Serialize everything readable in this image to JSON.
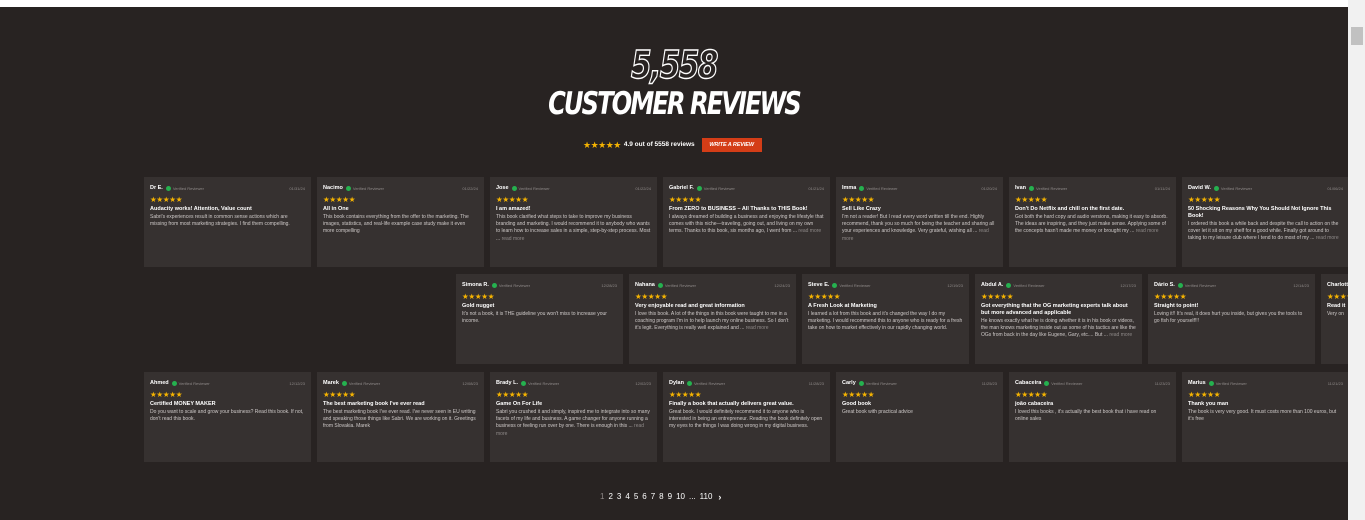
{
  "header": {
    "count": "5,558",
    "title": "CUSTOMER REVIEWS",
    "stars": "★★★★★",
    "summary": "4.9 out of 5558 reviews",
    "write_button": "WRITE A REVIEW"
  },
  "verified_label": "Verified Reviewer",
  "read_more": "read more",
  "rows": [
    [
      {
        "author": "Dr E.",
        "date": "01/31/24",
        "stars": "★★★★★",
        "title": "Audacity works! Attention, Value count",
        "body": "Sabri's experiences result in common sense actions which are missing from most marketing strategies. I find them compelling.",
        "more": false
      },
      {
        "author": "Nacimo",
        "date": "01/22/24",
        "stars": "★★★★★",
        "title": "All in One",
        "body": "This book contains everything from the offer to the marketing. The images, statistics, and real-life example case study make it even more compelling",
        "more": false
      },
      {
        "author": "Jose",
        "date": "01/22/24",
        "stars": "★★★★★",
        "title": "I am amazed!",
        "body": "This book clarified what steps to take to improve my business branding and marketing. I would recommend it to anybody who wants to learn how to increase sales in a simple, step-by-step process. Most ...",
        "more": true
      },
      {
        "author": "Gabriel F.",
        "date": "01/21/24",
        "stars": "★★★★★",
        "title": "From ZERO to BUSINESS – All Thanks to THIS Book!",
        "body": "I always dreamed of building a business and enjoying the lifestyle that comes with this niche—traveling, going out, and living on my own terms. Thanks to this book, six months ago, I went from ...",
        "more": true
      },
      {
        "author": "Imma",
        "date": "01/20/24",
        "stars": "★★★★★",
        "title": "Sell Like Crazy",
        "body": "I'm not a reader! But I read every word written till the end. Highly recommend, thank you so much for being the teacher and sharing all your experiences and knowledge. Very grateful, wishing all ...",
        "more": true
      },
      {
        "author": "Ivan",
        "date": "01/11/24",
        "stars": "★★★★★",
        "title": "Don't Do Netflix and chill on the first date.",
        "body": "Got both the hard copy and audio versions, making it easy to absorb. The ideas are inspiring, and they just make sense. Applying some of the concepts hasn't made me money or brought my ...",
        "more": true
      },
      {
        "author": "David W.",
        "date": "01/06/24",
        "stars": "★★★★★",
        "title": "50 Shocking Reasons Why You Should Not Ignore This Book!",
        "body": "I ordered this book a while back and despite the call to action on the cover let it sit on my shelf for a good while. Finally got around to taking to my leisure club where I tend to do most of my ...",
        "more": true
      }
    ],
    [
      {
        "author": "Simona R.",
        "date": "12/28/23",
        "stars": "★★★★★",
        "title": "Gold nugget",
        "body": "It's not a book, it is THE guideline you won't miss to increase your income.",
        "more": false
      },
      {
        "author": "Nahana",
        "date": "12/24/23",
        "stars": "★★★★★",
        "title": "Very enjoyable read and great information",
        "body": "I love this book. A lot of the things in this book were taught to me in a coaching program I'm in to help launch my online business. So I don't it's legit. Everything is really well explained and ...",
        "more": true
      },
      {
        "author": "Steve E.",
        "date": "12/19/23",
        "stars": "★★★★★",
        "title": "A Fresh Look at Marketing",
        "body": "I learned a lot from this book and it's changed the way I do my marketing. I would recommend this to anyone who is ready for a fresh take on how to market effectively in our rapidly changing world.",
        "more": false
      },
      {
        "author": "Abdul A.",
        "date": "12/17/23",
        "stars": "★★★★★",
        "title": "Got everything that the OG marketing experts talk about but more advanced and applicable",
        "body": "He knows exactly what he is doing whether it is in his book or videos, the man knows marketing inside out as some of his tactics are like the OGs from back in the day like Eugene, Gary, etc.... But ...",
        "more": true
      },
      {
        "author": "Dário S.",
        "date": "12/14/23",
        "stars": "★★★★★",
        "title": "Straight to point!",
        "body": "Loving it!! It's real, it does hurt you inside, but gives you the tools to go fish for yourself!!!",
        "more": false
      },
      {
        "author": "Charlotte",
        "date": "",
        "stars": "★★★★★",
        "title": "Read it",
        "body": "Very on",
        "more": false
      }
    ],
    [
      {
        "author": "Ahmed",
        "date": "12/12/23",
        "stars": "★★★★★",
        "title": "Certified MONEY MAKER",
        "body": "Do you want to scale and grow your business? Read this book. If not, don't read this book.",
        "more": false
      },
      {
        "author": "Marek",
        "date": "12/08/23",
        "stars": "★★★★★",
        "title": "The best marketing book I've ever read",
        "body": "The best marketing book I've ever read. I've never seen in EU writing and speaking those things like Sabri. We are working on it. Greetings from Slovakia. Marek",
        "more": false
      },
      {
        "author": "Brady L.",
        "date": "12/02/23",
        "stars": "★★★★★",
        "title": "Game On For Life",
        "body": "Sabri you crushed it and simply, inspired me to integrate into so many facets of my life and business. A game changer for anyone running a business or feeling run over by one. There is enough in this ...",
        "more": true
      },
      {
        "author": "Dylan",
        "date": "11/28/23",
        "stars": "★★★★★",
        "title": "Finally a book that actually delivers great value.",
        "body": "Great book. I would definitely recommend it to anyone who is interested in being an entrepreneur. Reading the book definitely open my eyes to the things I was doing wrong in my digital business.",
        "more": false
      },
      {
        "author": "Carly",
        "date": "11/25/23",
        "stars": "★★★★★",
        "title": "Good book",
        "body": "Great book with practical advice",
        "more": false
      },
      {
        "author": "Cabaceira",
        "date": "11/23/23",
        "stars": "★★★★★",
        "title": "joão cabaceira",
        "body": "I loved this books , it's actually the best book that i have read on online sales",
        "more": false
      },
      {
        "author": "Marius",
        "date": "11/21/23",
        "stars": "★★★★★",
        "title": "Thank you man",
        "body": "The book is very very good. It must costs more than 100 euros, but it's free",
        "more": false
      }
    ]
  ],
  "pagination": {
    "pages": [
      "1",
      "2",
      "3",
      "4",
      "5",
      "6",
      "7",
      "8",
      "9",
      "10",
      "...",
      "110"
    ],
    "next": "›"
  }
}
